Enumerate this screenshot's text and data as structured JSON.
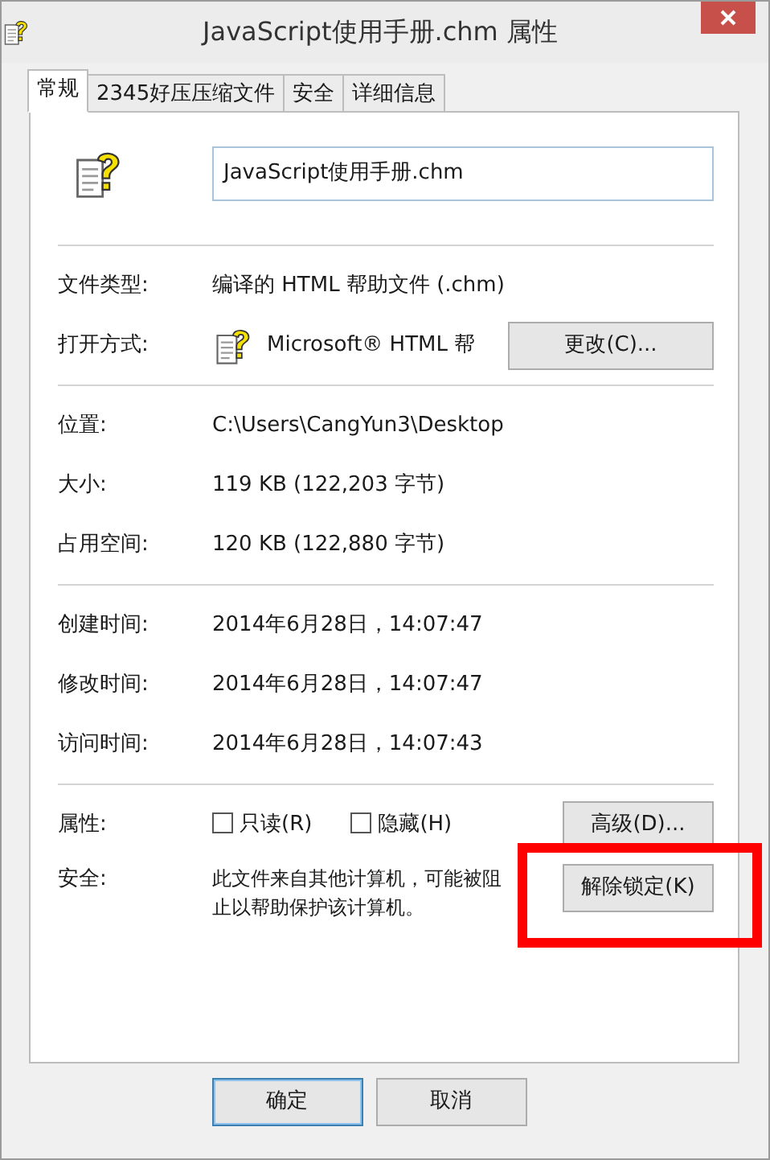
{
  "window": {
    "title": "JavaScript使用手册.chm 属性"
  },
  "tabs": [
    {
      "label": "常规",
      "selected": true
    },
    {
      "label": "2345好压压缩文件",
      "selected": false
    },
    {
      "label": "安全",
      "selected": false
    },
    {
      "label": "详细信息",
      "selected": false
    }
  ],
  "file_name": {
    "value": "JavaScript使用手册.chm"
  },
  "groups": [
    {
      "rows": [
        {
          "kind": "text",
          "label": "文件类型:",
          "value": "编译的 HTML 帮助文件 (.chm)"
        },
        {
          "kind": "app",
          "label": "打开方式:",
          "value": "Microsoft® HTML 帮",
          "button": {
            "label": "更改(C)..."
          }
        }
      ]
    },
    {
      "rows": [
        {
          "kind": "text",
          "label": "位置:",
          "value": "C:\\Users\\CangYun3\\Desktop"
        },
        {
          "kind": "text",
          "label": "大小:",
          "value": "119 KB (122,203 字节)"
        },
        {
          "kind": "text",
          "label": "占用空间:",
          "value": "120 KB (122,880 字节)"
        }
      ]
    },
    {
      "rows": [
        {
          "kind": "text",
          "label": "创建时间:",
          "value": "2014年6月28日，14:07:47"
        },
        {
          "kind": "text",
          "label": "修改时间:",
          "value": "2014年6月28日，14:07:47"
        },
        {
          "kind": "text",
          "label": "访问时间:",
          "value": "2014年6月28日，14:07:43"
        }
      ]
    },
    {
      "rows": [
        {
          "kind": "attributes",
          "label": "属性:",
          "checkboxes": [
            {
              "label": "只读(R)",
              "checked": false
            },
            {
              "label": "隐藏(H)",
              "checked": false
            }
          ],
          "button": {
            "label": "高级(D)..."
          }
        },
        {
          "kind": "security",
          "label": "安全:",
          "value": "此文件来自其他计算机，可能被阻止以帮助保护该计算机。",
          "button": {
            "label": "解除锁定(K)",
            "highlighted": true
          }
        }
      ]
    }
  ],
  "buttons": [
    {
      "label": "确定",
      "default": true
    },
    {
      "label": "取消",
      "default": false
    }
  ]
}
